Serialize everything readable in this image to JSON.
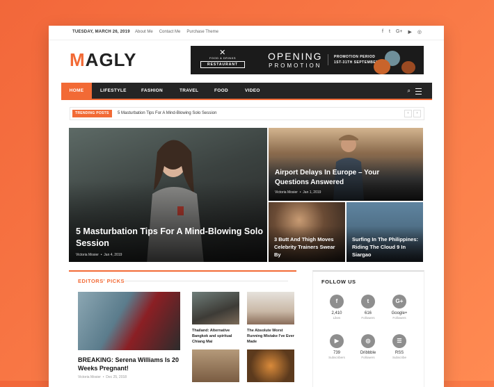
{
  "topbar": {
    "date": "TUESDAY, MARCH 26, 2019",
    "links": [
      "About Me",
      "Contact Me",
      "Purchase Theme"
    ],
    "social_icons": [
      "facebook-icon",
      "twitter-icon",
      "google-plus-icon",
      "youtube-icon",
      "instagram-icon"
    ]
  },
  "logo": {
    "first": "M",
    "rest": "AGLY"
  },
  "ad": {
    "food": "FOOD & DRINKS",
    "restaurant": "RESTAURANT",
    "opening": "OPENING",
    "promotion": "PROMOTION",
    "period_title": "PROMOTION PERIOD",
    "period_dates": "1ST-31TH SEPTEMBER"
  },
  "nav": {
    "items": [
      "HOME",
      "LIFESTYLE",
      "FASHION",
      "TRAVEL",
      "FOOD",
      "VIDEO"
    ],
    "active": "HOME"
  },
  "trending": {
    "label": "TRENDING POSTS",
    "text": "5 Masturbation Tips For A Mind-Blowing Solo Session"
  },
  "hero": [
    {
      "title": "5 Masturbation Tips For A Mind-Blowing Solo Session",
      "author": "Victoria Mosier",
      "date": "Jan 4, 2019"
    },
    {
      "title": "Airport Delays In Europe – Your Questions Answered",
      "author": "Victoria Mosier",
      "date": "Jan 1, 2019"
    },
    {
      "title": "3 Butt And Thigh Moves Celebrity Trainers Swear By"
    },
    {
      "title": "Surfing In The Philippines: Riding The Cloud 9 In Siargao"
    }
  ],
  "editors": {
    "heading": "EDITORS' PICKS",
    "featured": {
      "title": "BREAKING: Serena Williams Is 20 Weeks Pregnant!",
      "author": "Victoria Mosier",
      "date": "Dec 25, 2018"
    },
    "small": [
      {
        "title": "Thailand: Alternative Bangkok and spiritual Chiang Mai"
      },
      {
        "title": "The Absolute Worst Running Mistake I've Ever Made"
      }
    ]
  },
  "follow": {
    "heading": "FOLLOW US",
    "items": [
      {
        "glyph": "f",
        "count": "2,410",
        "label": "Likes",
        "icon": "facebook-icon"
      },
      {
        "glyph": "t",
        "count": "616",
        "label": "Followers",
        "icon": "twitter-icon"
      },
      {
        "glyph": "G+",
        "count": "Google+",
        "label": "Followers",
        "icon": "google-plus-icon"
      },
      {
        "glyph": "▶",
        "count": "739",
        "label": "Subscribers",
        "icon": "youtube-icon"
      },
      {
        "glyph": "◎",
        "count": "Dribbble",
        "label": "Followers",
        "icon": "dribbble-icon"
      },
      {
        "glyph": "☰",
        "count": "RSS",
        "label": "Subscribe",
        "icon": "rss-icon"
      }
    ]
  },
  "colors": {
    "accent": "#f26a35",
    "nav_bg": "#252525",
    "page_bg": "#ff7a45"
  }
}
